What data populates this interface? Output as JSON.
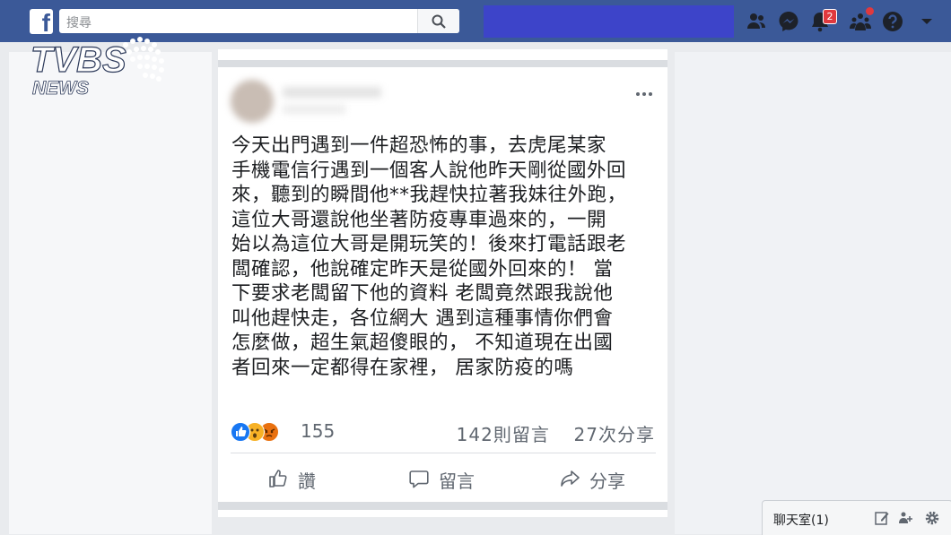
{
  "header": {
    "logo_letter": "f",
    "search_placeholder": "搜尋",
    "notification_count": "2",
    "icons": [
      "friends-icon",
      "messenger-icon",
      "notifications-icon",
      "groups-icon",
      "help-icon",
      "dropdown-icon"
    ]
  },
  "watermark": {
    "brand": "TVBS",
    "sub": "NEWS"
  },
  "post": {
    "text": "今天出門遇到一件超恐怖的事，去虎尾某家\n手機電信行遇到一個客人說他昨天剛從國外回\n來，聽到的瞬間他**我趕快拉著我妹往外跑，\n這位大哥還說他坐著防疫專車過來的，一開\n始以為這位大哥是開玩笑的！後來打電話跟老\n闆確認，他說確定昨天是從國外回來的！ 當\n下要求老闆留下他的資料 老闆竟然跟我說他\n叫他趕快走，各位網大 遇到這種事情你們會\n怎麼做，超生氣超傻眼的， 不知道現在出國\n者回來一定都得在家裡， 居家防疫的嗎",
    "reaction_count": "155",
    "reaction_icons": [
      "like-icon",
      "wow-icon",
      "angry-icon"
    ],
    "comments_label": "142則留言",
    "shares_label": "27次分享",
    "actions": {
      "like": "讚",
      "comment": "留言",
      "share": "分享"
    }
  },
  "chat": {
    "label": "聊天室(1)"
  },
  "colors": {
    "header_bg": "#3b5998",
    "page_bg": "#e9ebee",
    "badge": "#e0393e"
  }
}
